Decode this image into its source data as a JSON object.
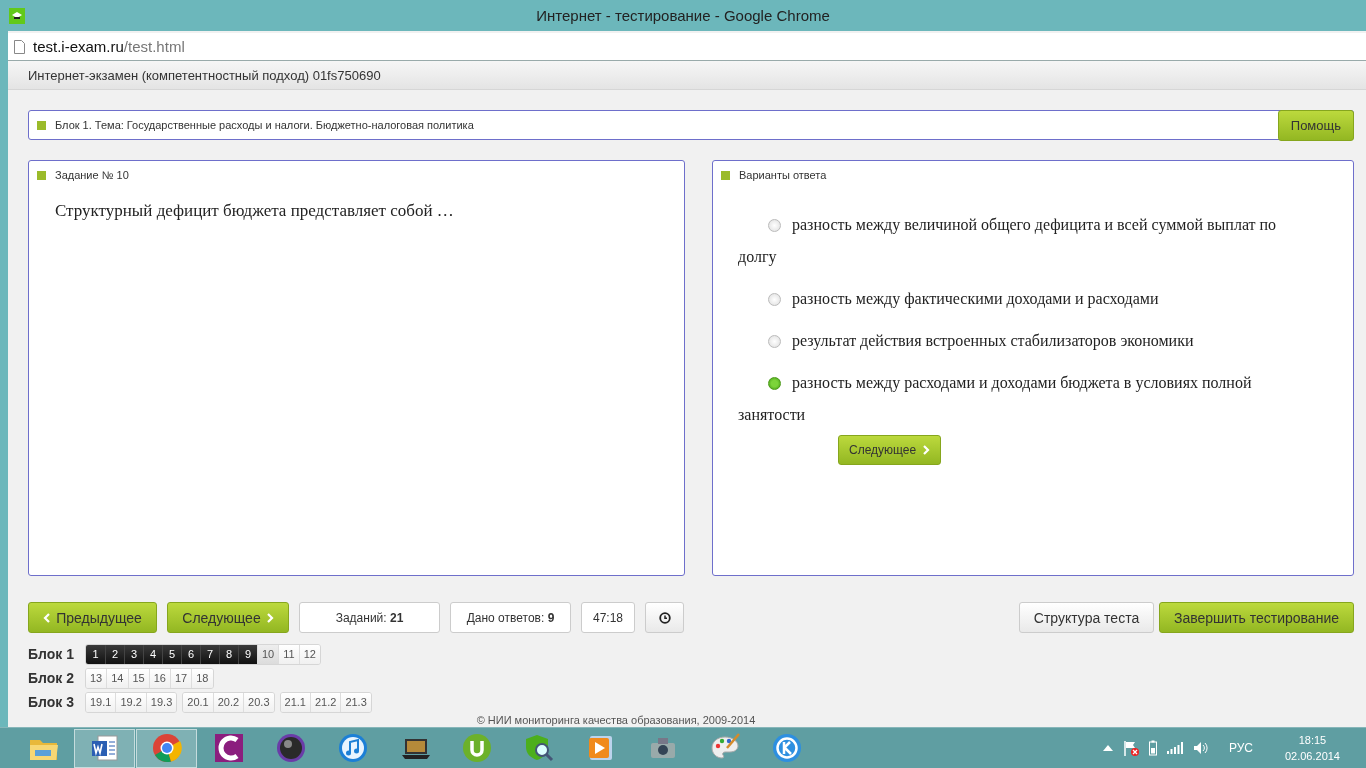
{
  "window": {
    "title": "Интернет - тестирование - Google Chrome"
  },
  "address_bar": {
    "host": "test.i-exam.ru",
    "path": "/test.html"
  },
  "page_header": "Интернет-экзамен (компетентностный подход) 01fs750690",
  "topic": {
    "text": "Блок 1. Тема: Государственные расходы и налоги. Бюджетно-налоговая политика",
    "help_button": "Помощь"
  },
  "task": {
    "heading": "Задание № 10",
    "question": "Структурный дефицит бюджета представляет собой …"
  },
  "answers": {
    "heading": "Варианты ответа",
    "next_button": "Следующее",
    "options": [
      {
        "text": "разность между величиной общего дефицита и всей суммой выплат по долгу",
        "selected": false
      },
      {
        "text": "разность между фактическими доходами и расходами",
        "selected": false
      },
      {
        "text": "результат действия встроенных стабилизаторов экономики",
        "selected": false
      },
      {
        "text": "разность между расходами и доходами бюджета в условиях полной занятости",
        "selected": true
      }
    ]
  },
  "nav": {
    "prev_button": "Предыдущее",
    "next_button": "Следующее",
    "tasks_count": "Заданий: **21**",
    "answered_count": "Дано ответов: **9**",
    "timer": "47:18",
    "structure_button": "Структура теста",
    "finish_button": "Завершить тестирование"
  },
  "blocks": [
    {
      "label": "Блок 1",
      "groups": [
        {
          "items": [
            {
              "label": "1",
              "answered": true,
              "current": false
            },
            {
              "label": "2",
              "answered": true,
              "current": false
            },
            {
              "label": "3",
              "answered": true,
              "current": false
            },
            {
              "label": "4",
              "answered": true,
              "current": false
            },
            {
              "label": "5",
              "answered": true,
              "current": false
            },
            {
              "label": "6",
              "answered": true,
              "current": false
            },
            {
              "label": "7",
              "answered": true,
              "current": false
            },
            {
              "label": "8",
              "answered": true,
              "current": false
            },
            {
              "label": "9",
              "answered": true,
              "current": false
            },
            {
              "label": "10",
              "answered": false,
              "current": true
            },
            {
              "label": "11",
              "answered": false,
              "current": false
            },
            {
              "label": "12",
              "answered": false,
              "current": false
            }
          ]
        }
      ]
    },
    {
      "label": "Блок 2",
      "groups": [
        {
          "items": [
            {
              "label": "13",
              "answered": false,
              "current": false
            },
            {
              "label": "14",
              "answered": false,
              "current": false
            },
            {
              "label": "15",
              "answered": false,
              "current": false
            },
            {
              "label": "16",
              "answered": false,
              "current": false
            },
            {
              "label": "17",
              "answered": false,
              "current": false
            },
            {
              "label": "18",
              "answered": false,
              "current": false
            }
          ]
        }
      ]
    },
    {
      "label": "Блок 3",
      "groups": [
        {
          "items": [
            {
              "label": "19.1",
              "answered": false,
              "current": false
            },
            {
              "label": "19.2",
              "answered": false,
              "current": false
            },
            {
              "label": "19.3",
              "answered": false,
              "current": false
            }
          ]
        },
        {
          "items": [
            {
              "label": "20.1",
              "answered": false,
              "current": false
            },
            {
              "label": "20.2",
              "answered": false,
              "current": false
            },
            {
              "label": "20.3",
              "answered": false,
              "current": false
            }
          ]
        },
        {
          "items": [
            {
              "label": "21.1",
              "answered": false,
              "current": false
            },
            {
              "label": "21.2",
              "answered": false,
              "current": false
            },
            {
              "label": "21.3",
              "answered": false,
              "current": false
            }
          ]
        }
      ]
    }
  ],
  "footer": "© НИИ мониторинга качества образования, 2009-2014",
  "taskbar": {
    "apps": [
      {
        "kind": "folder",
        "open": false
      },
      {
        "kind": "document",
        "open": true
      },
      {
        "kind": "browser",
        "open": true
      },
      {
        "kind": "crescent",
        "open": false
      },
      {
        "kind": "knob",
        "open": false
      },
      {
        "kind": "music",
        "open": false
      },
      {
        "kind": "laptop",
        "open": false
      },
      {
        "kind": "torrent",
        "open": false
      },
      {
        "kind": "shield",
        "open": false
      },
      {
        "kind": "player",
        "open": false
      },
      {
        "kind": "camera",
        "open": false
      },
      {
        "kind": "palette",
        "open": false
      },
      {
        "kind": "ring",
        "open": false
      }
    ],
    "language": "РУС",
    "time": "18:15",
    "date": "02.06.2014"
  }
}
